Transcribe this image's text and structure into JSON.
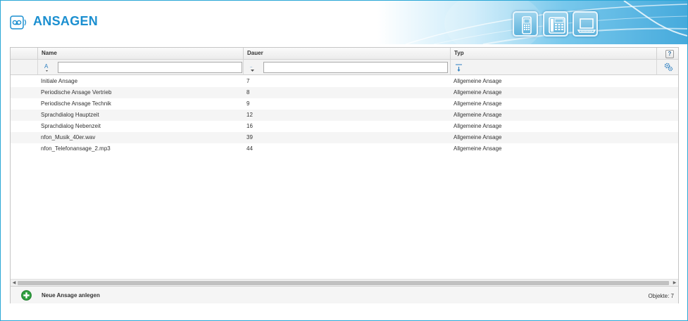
{
  "app": {
    "title": "ANSAGEN",
    "accent": "#1b8fd0",
    "logo_icon": "voicemail-icon"
  },
  "header_devices": [
    {
      "name": "mobile-phone-icon"
    },
    {
      "name": "desk-phone-icon"
    },
    {
      "name": "laptop-icon"
    }
  ],
  "grid": {
    "columns": [
      {
        "label": "Name",
        "filter_icon": "alpha-sort-icon",
        "filter_value": ""
      },
      {
        "label": "Dauer",
        "filter_icon": "numeric-sort-icon",
        "filter_value": ""
      },
      {
        "label": "Typ",
        "filter_icon": "sort-descending-icon"
      }
    ],
    "help_label": "?",
    "rows": [
      {
        "name": "Initiale Ansage",
        "dauer": "7",
        "typ": "Allgemeine Ansage"
      },
      {
        "name": "Periodische Ansage Vertrieb",
        "dauer": "8",
        "typ": "Allgemeine Ansage"
      },
      {
        "name": "Periodische Ansage Technik",
        "dauer": "9",
        "typ": "Allgemeine Ansage"
      },
      {
        "name": "Sprachdialog Hauptzeit",
        "dauer": "12",
        "typ": "Allgemeine Ansage"
      },
      {
        "name": "Sprachdialog Nebenzeit",
        "dauer": "16",
        "typ": "Allgemeine Ansage"
      },
      {
        "name": "nfon_Musik_40er.wav",
        "dauer": "39",
        "typ": "Allgemeine Ansage"
      },
      {
        "name": "nfon_Telefonansage_2.mp3",
        "dauer": "44",
        "typ": "Allgemeine Ansage"
      }
    ]
  },
  "footer": {
    "add_label": "Neue Ansage anlegen",
    "count_label": "Objekte: 7",
    "add_color": "#2e9e3e"
  }
}
